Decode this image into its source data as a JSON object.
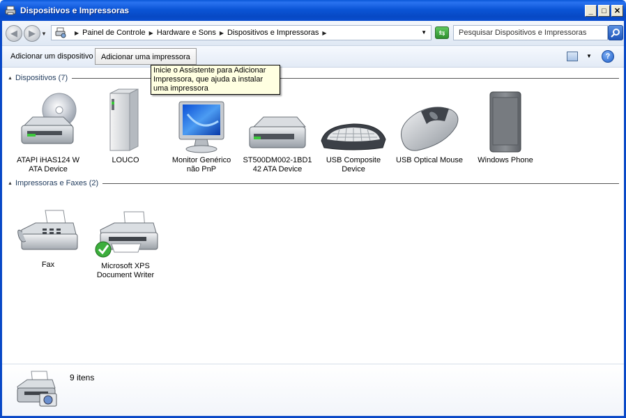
{
  "window": {
    "title": "Dispositivos e Impressoras",
    "minimize": "_",
    "maximize": "□",
    "close": "✕"
  },
  "address": {
    "crumbs": [
      "Painel de Controle",
      "Hardware e Sons",
      "Dispositivos e Impressoras"
    ],
    "search_placeholder": "Pesquisar Dispositivos e Impressoras"
  },
  "commands": {
    "add_device": "Adicionar um dispositivo",
    "add_printer": "Adicionar uma impressora",
    "help": "?"
  },
  "tooltip": "Inicie o Assistente para Adicionar Impressora, que ajuda a instalar uma impressora",
  "groups": {
    "devices_title": "Dispositivos (7)",
    "printers_title": "Impressoras e Faxes (2)"
  },
  "devices": [
    {
      "line1": "ATAPI iHAS124   W",
      "line2": "ATA Device",
      "icon": "optical-drive-icon"
    },
    {
      "line1": "LOUCO",
      "line2": "",
      "icon": "computer-tower-icon"
    },
    {
      "line1": "Monitor Genérico",
      "line2": "não PnP",
      "icon": "monitor-icon"
    },
    {
      "line1": "ST500DM002-1BD1",
      "line2": "42 ATA Device",
      "icon": "hard-drive-icon"
    },
    {
      "line1": "USB Composite",
      "line2": "Device",
      "icon": "keyboard-icon"
    },
    {
      "line1": "USB Optical Mouse",
      "line2": "",
      "icon": "mouse-icon"
    },
    {
      "line1": "Windows Phone",
      "line2": "",
      "icon": "phone-icon"
    }
  ],
  "printers": [
    {
      "line1": "Fax",
      "line2": "",
      "icon": "fax-icon"
    },
    {
      "line1": "Microsoft XPS",
      "line2": "Document Writer",
      "icon": "printer-icon",
      "default": true
    }
  ],
  "details": {
    "count": "9 itens"
  }
}
